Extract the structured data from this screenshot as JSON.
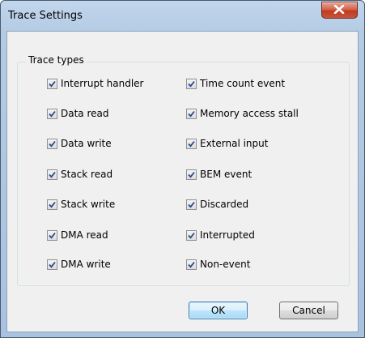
{
  "dialog": {
    "title": "Trace Settings"
  },
  "group": {
    "label": "Trace types",
    "left_column": [
      {
        "label": "Interrupt handler",
        "checked": true
      },
      {
        "label": "Data read",
        "checked": true
      },
      {
        "label": "Data write",
        "checked": true
      },
      {
        "label": "Stack read",
        "checked": true
      },
      {
        "label": "Stack write",
        "checked": true
      },
      {
        "label": "DMA read",
        "checked": true
      },
      {
        "label": "DMA write",
        "checked": true
      }
    ],
    "right_column": [
      {
        "label": "Time count event",
        "checked": true
      },
      {
        "label": "Memory access stall",
        "checked": true
      },
      {
        "label": "External input",
        "checked": true
      },
      {
        "label": "BEM event",
        "checked": true
      },
      {
        "label": "Discarded",
        "checked": true
      },
      {
        "label": "Interrupted",
        "checked": true
      },
      {
        "label": "Non-event",
        "checked": true
      }
    ]
  },
  "buttons": {
    "ok": "OK",
    "cancel": "Cancel"
  }
}
